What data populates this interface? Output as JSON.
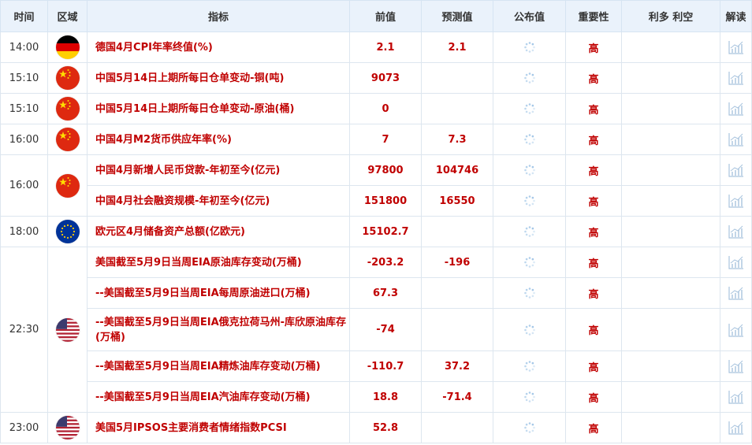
{
  "header": {
    "time": "时间",
    "region": "区域",
    "indicator": "指标",
    "prev": "前值",
    "forecast": "预测值",
    "actual": "公布值",
    "importance": "重要性",
    "bullbear": "利多 利空",
    "interpret": "解读"
  },
  "groups": [
    {
      "time": "14:00",
      "flag": "germany-flag-icon",
      "rows": [
        {
          "indicator": "德国4月CPI年率终值(%)",
          "prev": "2.1",
          "forecast": "2.1",
          "importance": "高"
        }
      ]
    },
    {
      "time": "15:10",
      "flag": "china-flag-icon",
      "rows": [
        {
          "indicator": "中国5月14日上期所每日仓单变动-铜(吨)",
          "prev": "9073",
          "forecast": "",
          "importance": "高"
        }
      ]
    },
    {
      "time": "15:10",
      "flag": "china-flag-icon",
      "rows": [
        {
          "indicator": "中国5月14日上期所每日仓单变动-原油(桶)",
          "prev": "0",
          "forecast": "",
          "importance": "高"
        }
      ]
    },
    {
      "time": "16:00",
      "flag": "china-flag-icon",
      "rows": [
        {
          "indicator": "中国4月M2货币供应年率(%)",
          "prev": "7",
          "forecast": "7.3",
          "importance": "高"
        }
      ]
    },
    {
      "time": "16:00",
      "flag": "china-flag-icon",
      "rows": [
        {
          "indicator": "中国4月新增人民币贷款-年初至今(亿元)",
          "prev": "97800",
          "forecast": "104746",
          "importance": "高"
        },
        {
          "indicator": "中国4月社会融资规模-年初至今(亿元)",
          "prev": "151800",
          "forecast": "16550",
          "importance": "高"
        }
      ]
    },
    {
      "time": "18:00",
      "flag": "eu-flag-icon",
      "rows": [
        {
          "indicator": "欧元区4月储备资产总额(亿欧元)",
          "prev": "15102.7",
          "forecast": "",
          "importance": "高"
        }
      ]
    },
    {
      "time": "22:30",
      "flag": "usa-flag-icon",
      "rows": [
        {
          "indicator": "美国截至5月9日当周EIA原油库存变动(万桶)",
          "prev": "-203.2",
          "forecast": "-196",
          "importance": "高"
        },
        {
          "indicator": "--美国截至5月9日当周EIA每周原油进口(万桶)",
          "prev": "67.3",
          "forecast": "",
          "importance": "高"
        },
        {
          "indicator": "--美国截至5月9日当周EIA俄克拉荷马州-库欣原油库存(万桶)",
          "prev": "-74",
          "forecast": "",
          "importance": "高",
          "tall": true
        },
        {
          "indicator": "--美国截至5月9日当周EIA精炼油库存变动(万桶)",
          "prev": "-110.7",
          "forecast": "37.2",
          "importance": "高"
        },
        {
          "indicator": "--美国截至5月9日当周EIA汽油库存变动(万桶)",
          "prev": "18.8",
          "forecast": "-71.4",
          "importance": "高"
        }
      ]
    },
    {
      "time": "23:00",
      "flag": "usa-flag-icon",
      "rows": [
        {
          "indicator": "美国5月IPSOS主要消费者情绪指数PCSI",
          "prev": "52.8",
          "forecast": "",
          "importance": "高"
        }
      ]
    }
  ]
}
